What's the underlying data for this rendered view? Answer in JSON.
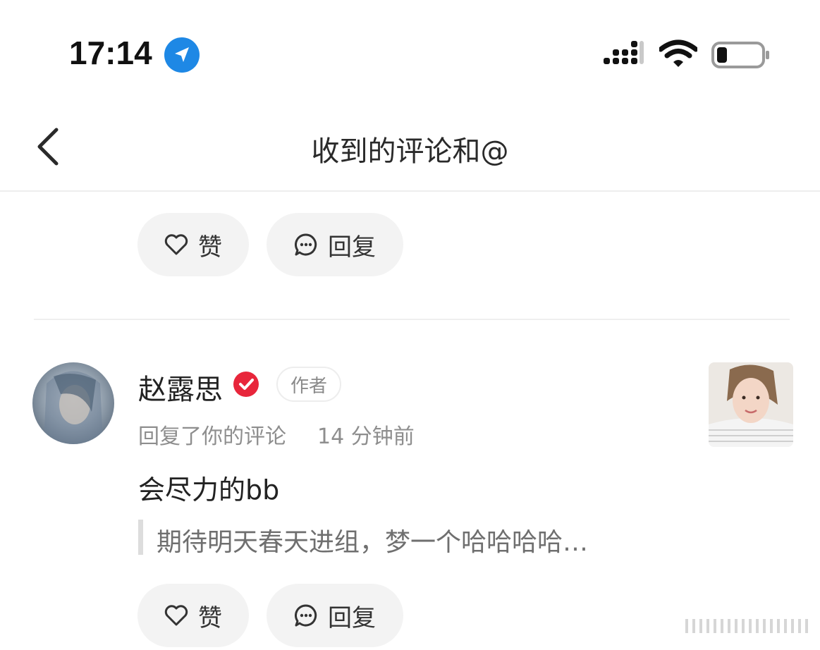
{
  "status_bar": {
    "time": "17:14",
    "icons": [
      "location-arrow-icon",
      "cellular-signal-icon",
      "wifi-icon",
      "battery-icon"
    ]
  },
  "nav": {
    "title": "收到的评论和@",
    "back_icon": "chevron-left-icon"
  },
  "previous_item": {
    "like_label": "赞",
    "reply_label": "回复"
  },
  "comment": {
    "user_name": "赵露思",
    "verified_icon": "verified-check-icon",
    "author_badge": "作者",
    "action": "回复了你的评论",
    "time": "14 分钟前",
    "text": "会尽力的bb",
    "quoted": "期待明天春天进组，梦一个哈哈哈哈…",
    "like_label": "赞",
    "reply_label": "回复"
  },
  "colors": {
    "accent_blue": "#1e88e5",
    "verified_red": "#e8263b",
    "pill_bg": "#f3f3f3",
    "secondary_text": "#8e8e8e"
  }
}
